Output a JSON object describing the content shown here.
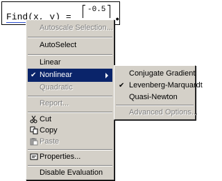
{
  "expression": {
    "text": "Find(x, y) =",
    "matrix_value": "-0.5",
    "trailing_mark": "•"
  },
  "context_menu": {
    "items": [
      {
        "label": "Autoscale Selection...",
        "disabled": true
      },
      {
        "label": "AutoSelect",
        "disabled": false
      },
      {
        "label": "Linear",
        "disabled": false
      },
      {
        "label": "Nonlinear",
        "disabled": false,
        "checked": true,
        "highlighted": true,
        "has_submenu": true
      },
      {
        "label": "Quadratic",
        "disabled": true
      },
      {
        "label": "Report...",
        "disabled": true
      },
      {
        "label": "Cut",
        "disabled": false,
        "icon": "scissors-icon"
      },
      {
        "label": "Copy",
        "disabled": false,
        "icon": "copy-icon"
      },
      {
        "label": "Paste",
        "disabled": true,
        "icon": "paste-icon"
      },
      {
        "label": "Properties...",
        "disabled": false,
        "icon": "properties-icon"
      },
      {
        "label": "Disable Evaluation",
        "disabled": false
      }
    ]
  },
  "submenu": {
    "items": [
      {
        "label": "Conjugate Gradient",
        "disabled": false
      },
      {
        "label": "Levenberg-Marquardt",
        "disabled": false,
        "checked": true
      },
      {
        "label": "Quasi-Newton",
        "disabled": false
      },
      {
        "label": "Advanced Options...",
        "disabled": true
      }
    ]
  },
  "colors": {
    "menu_face": "#d4d0c8",
    "highlight": "#0a246a",
    "disabled_text": "#808080"
  }
}
